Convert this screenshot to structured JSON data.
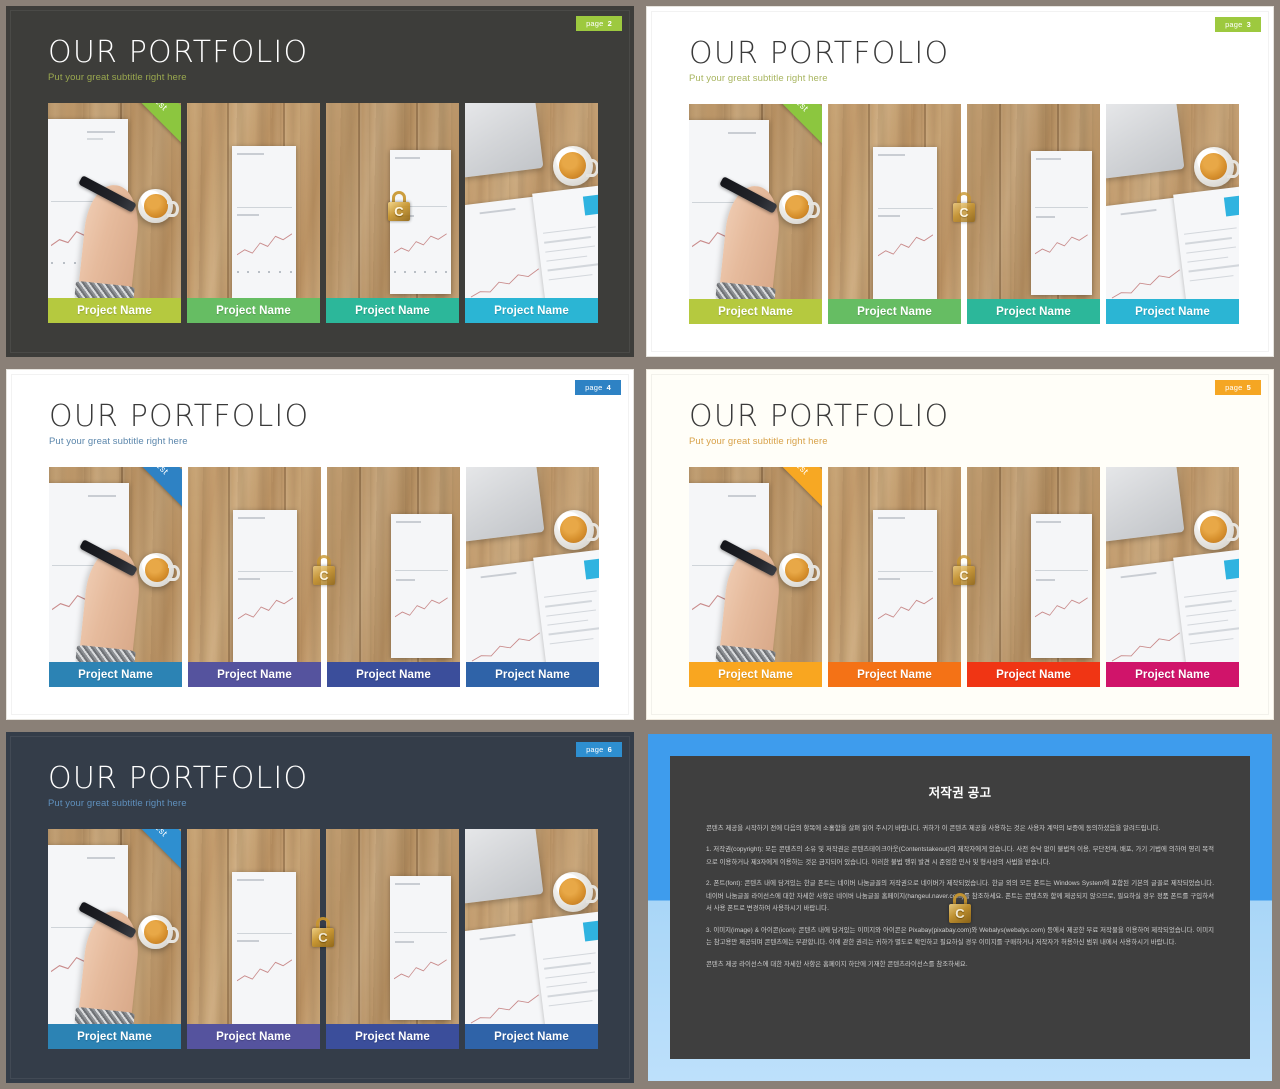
{
  "common": {
    "title": "OUR PORTFOLIO",
    "subtitle": "Put your great subtitle right here",
    "ribbon_label": "Best",
    "project_label": "Project Name",
    "page_word": "page",
    "watermark_letter": "C"
  },
  "slides": [
    {
      "id": "slide-green-dark",
      "theme": "dark",
      "page_number": "2",
      "badge_color": "#9dc93f",
      "title_color": "#ffffff",
      "subtitle_color": "#9aa84f",
      "ribbon_color": "#8cc63f",
      "background": "#3d3d3a",
      "bars": [
        {
          "label": "Project Name",
          "color": "#b5c93f"
        },
        {
          "label": "Project Name",
          "color": "#66bd63"
        },
        {
          "label": "Project Name",
          "color": "#2cb79a"
        },
        {
          "label": "Project Name",
          "color": "#2bb5d4"
        }
      ]
    },
    {
      "id": "slide-green-light",
      "theme": "white",
      "page_number": "3",
      "badge_color": "#9dc93f",
      "title_color": "#3a3a3a",
      "subtitle_color": "#a8b560",
      "ribbon_color": "#8cc63f",
      "background": "#ffffff",
      "bars": [
        {
          "label": "Project Name",
          "color": "#b5c93f"
        },
        {
          "label": "Project Name",
          "color": "#66bd63"
        },
        {
          "label": "Project Name",
          "color": "#2cb79a"
        },
        {
          "label": "Project Name",
          "color": "#2bb5d4"
        }
      ]
    },
    {
      "id": "slide-blue-light",
      "theme": "white",
      "page_number": "4",
      "badge_color": "#2e82c4",
      "title_color": "#3a3a3a",
      "subtitle_color": "#5b86ab",
      "ribbon_color": "#2e82c4",
      "background": "#ffffff",
      "bars": [
        {
          "label": "Project Name",
          "color": "#2c83b4"
        },
        {
          "label": "Project Name",
          "color": "#55539e"
        },
        {
          "label": "Project Name",
          "color": "#3b4e9b"
        },
        {
          "label": "Project Name",
          "color": "#2f63a8"
        }
      ]
    },
    {
      "id": "slide-orange-light",
      "theme": "cream",
      "page_number": "5",
      "badge_color": "#f5a623",
      "title_color": "#3a3a3a",
      "subtitle_color": "#d8a24a",
      "ribbon_color": "#f7a823",
      "background": "#fffef8",
      "bars": [
        {
          "label": "Project Name",
          "color": "#f9a620"
        },
        {
          "label": "Project Name",
          "color": "#f47216"
        },
        {
          "label": "Project Name",
          "color": "#f03514"
        },
        {
          "label": "Project Name",
          "color": "#d0146a"
        }
      ]
    },
    {
      "id": "slide-blue-dark",
      "theme": "navy",
      "page_number": "6",
      "badge_color": "#2e8fd0",
      "title_color": "#ffffff",
      "subtitle_color": "#5f90bd",
      "ribbon_color": "#2e8fd0",
      "background": "#343d49",
      "bars": [
        {
          "label": "Project Name",
          "color": "#2c83b4"
        },
        {
          "label": "Project Name",
          "color": "#55539e"
        },
        {
          "label": "Project Name",
          "color": "#3b4e9b"
        },
        {
          "label": "Project Name",
          "color": "#2f63a8"
        }
      ]
    }
  ],
  "copyright": {
    "heading": "저작권 공고",
    "paragraphs": [
      "콘텐츠 제공을 시작하기 전에 다음의 항목에 소홀함을 살펴 읽어 주시기 바랍니다. 귀하가 이 콘텐츠 제공을 사용하는 것은 사용자 계약의 보증에 동의하셨음을 알려드립니다.",
      "1. 저작권(copyright): 모든 콘텐츠의 소유 및 저작권은 콘텐츠테이크아웃(Contentstakeout)의 제작자에게 있습니다. 사전 승낙 없이 불법적 이용, 무단전재, 배포, 가기 기법에 의하여 영리 목적으로 이용하거나 제3자에게 이용하는 것은 금지되어 있습니다. 이러한 불법 행위 발견 시 준엄한 민사 및 형사상의 사법을 받습니다.",
      "2. 폰트(font): 콘텐츠 내에 담겨있는 한글 폰트는 네이버 나눔글꼴의 저작권으로 네이버가 제작되었습니다. 한글 외의 모든 폰트는 Windows System에 포함된 기본의 글꼴로 제작되었습니다. 네이버 나눔글꼴 라이선스에 대한 자세한 사항은 네이버 나눔글꼴 홈페이지(hangeul.naver.com)를 참조하세요. 폰트는 콘텐츠와 함께 제공되지 않으므로, 필요하실 경우 정품 폰트를 구입하셔서 사용 폰트로 변경하여 사용하시기 바랍니다.",
      "3. 이미지(image) & 아이콘(icon): 콘텐츠 내에 담겨있는 이미지와 아이콘은 Pixabay(pixabay.com)와 Webalys(webalys.com) 등에서 제공한 무료 저작물을 이용하여 제작되었습니다. 이미지는 참고용만 제공되며 콘텐츠에는 무관합니다. 이에 관한 권리는 귀하가 별도로 확인하고 필요하실 경우 이미지를 구매하거나 저작자가 허용하신 범위 내에서 사용하시기 바랍니다.",
      "콘텐츠 제공 라이선스에 대한 자세한 사항은 홈페이지 하단에 기재한 콘텐츠라이선스를 참조하세요."
    ]
  }
}
